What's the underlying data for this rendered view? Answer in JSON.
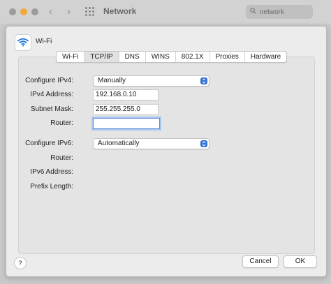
{
  "window": {
    "title": "Network",
    "search_placeholder": "network"
  },
  "sheet": {
    "interface_name": "Wi-Fi",
    "tabs": [
      "Wi-Fi",
      "TCP/IP",
      "DNS",
      "WINS",
      "802.1X",
      "Proxies",
      "Hardware"
    ],
    "active_tab": "TCP/IP",
    "ipv4": {
      "configure_label": "Configure IPv4:",
      "configure_value": "Manually",
      "address_label": "IPv4 Address:",
      "address_value": "192.168.0.10",
      "subnet_label": "Subnet Mask:",
      "subnet_value": "255.255.255.0",
      "router_label": "Router:",
      "router_value": ""
    },
    "ipv6": {
      "configure_label": "Configure IPv6:",
      "configure_value": "Automatically",
      "router_label": "Router:",
      "address_label": "IPv6 Address:",
      "prefix_label": "Prefix Length:"
    },
    "help_label": "?",
    "cancel_label": "Cancel",
    "ok_label": "OK"
  }
}
